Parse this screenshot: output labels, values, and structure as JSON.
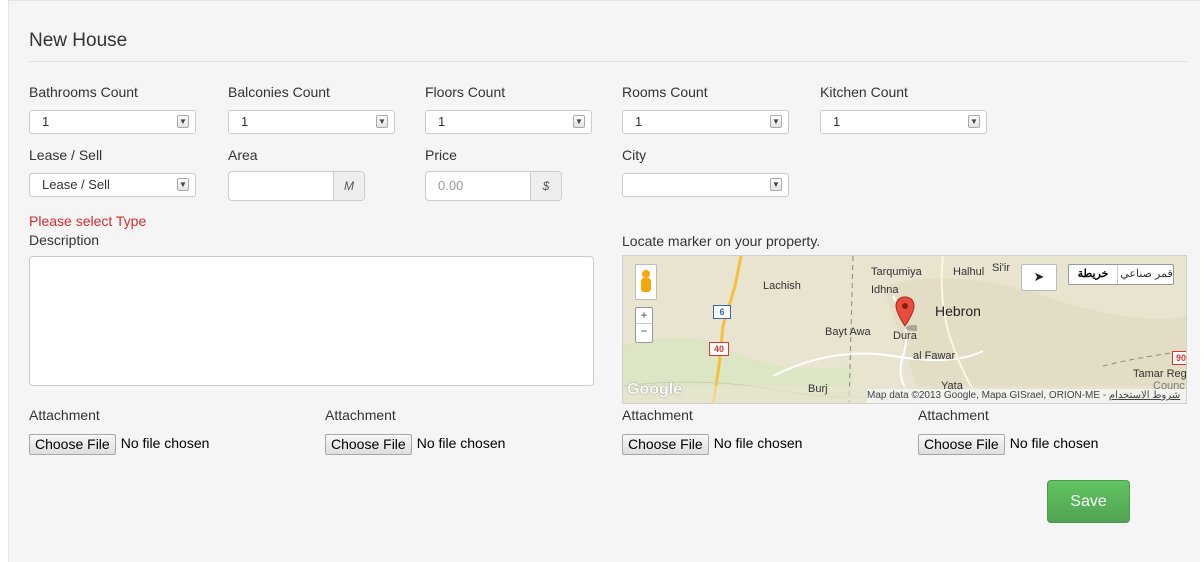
{
  "form": {
    "title": "New House",
    "bathrooms": {
      "label": "Bathrooms Count",
      "value": "1"
    },
    "balconies": {
      "label": "Balconies Count",
      "value": "1"
    },
    "floors": {
      "label": "Floors Count",
      "value": "1"
    },
    "rooms": {
      "label": "Rooms Count",
      "value": "1"
    },
    "kitchen": {
      "label": "Kitchen Count",
      "value": "1"
    },
    "lease": {
      "label": "Lease / Sell",
      "value": "Lease / Sell"
    },
    "area": {
      "label": "Area",
      "value": "",
      "unit": "M"
    },
    "price": {
      "label": "Price",
      "placeholder": "0.00",
      "unit": "$"
    },
    "city": {
      "label": "City",
      "value": ""
    },
    "error": "Please select Type",
    "description_label": "Description",
    "map_label": "Locate marker on your property.",
    "attachments": [
      {
        "label": "Attachment",
        "button": "Choose File",
        "status": "No file chosen"
      },
      {
        "label": "Attachment",
        "button": "Choose File",
        "status": "No file chosen"
      },
      {
        "label": "Attachment",
        "button": "Choose File",
        "status": "No file chosen"
      },
      {
        "label": "Attachment",
        "button": "Choose File",
        "status": "No file chosen"
      }
    ],
    "save_label": "Save"
  },
  "map": {
    "places": [
      "Tarqumiya",
      "Halhul",
      "Si'ir",
      "Idhna",
      "Lachish",
      "Hebron",
      "Bayt Awa",
      "Dura",
      "al Fawar",
      "Yata",
      "Burj",
      "Tamar Reg",
      "Counc"
    ],
    "roads": [
      "6",
      "40",
      "90"
    ],
    "type_satellite": "قمر صناعي",
    "type_map": "خريطة",
    "logo": "Google",
    "attribution": "Map data ©2013 Google, Mapa GISrael, ORION-ME",
    "terms": "شروط الاستخدام"
  },
  "colors": {
    "accent_green": "#5bb75b",
    "error_red": "#d92b2b",
    "marker_red": "#e94b3c"
  }
}
